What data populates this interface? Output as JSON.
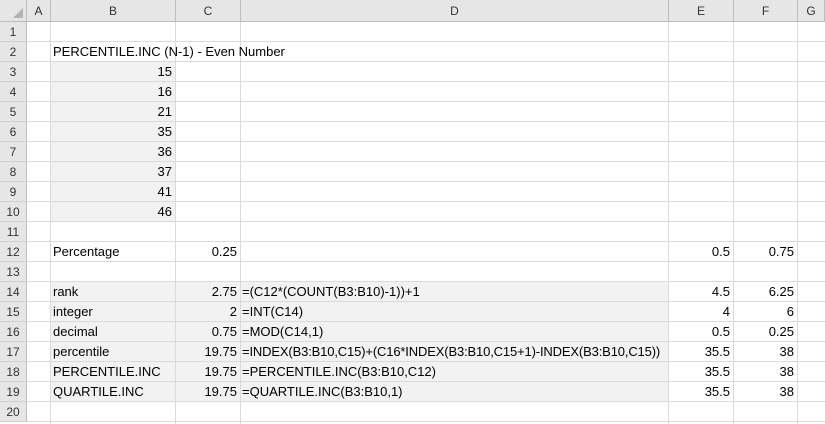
{
  "columns": [
    "A",
    "B",
    "C",
    "D",
    "E",
    "F",
    "G"
  ],
  "rows": [
    "1",
    "2",
    "3",
    "4",
    "5",
    "6",
    "7",
    "8",
    "9",
    "10",
    "11",
    "12",
    "13",
    "14",
    "15",
    "16",
    "17",
    "18",
    "19",
    "20"
  ],
  "title": "PERCENTILE.INC (N-1) - Even Number",
  "data_values": [
    "15",
    "16",
    "21",
    "35",
    "36",
    "37",
    "41",
    "46"
  ],
  "percentage": {
    "label": "Percentage",
    "c": "0.25",
    "e": "0.5",
    "f": "0.75"
  },
  "calc_rows": [
    {
      "label": "rank",
      "c": "2.75",
      "d": "=(C12*(COUNT(B3:B10)-1))+1",
      "e": "4.5",
      "f": "6.25"
    },
    {
      "label": "integer",
      "c": "2",
      "d": "=INT(C14)",
      "e": "4",
      "f": "6"
    },
    {
      "label": "decimal",
      "c": "0.75",
      "d": "=MOD(C14,1)",
      "e": "0.5",
      "f": "0.25"
    },
    {
      "label": "percentile",
      "c": "19.75",
      "d": "=INDEX(B3:B10,C15)+(C16*INDEX(B3:B10,C15+1)-INDEX(B3:B10,C15))",
      "e": "35.5",
      "f": "38"
    },
    {
      "label": "PERCENTILE.INC",
      "c": "19.75",
      "d": "=PERCENTILE.INC(B3:B10,C12)",
      "e": "35.5",
      "f": "38"
    },
    {
      "label": "QUARTILE.INC",
      "c": "19.75",
      "d": "=QUARTILE.INC(B3:B10,1)",
      "e": "35.5",
      "f": "38"
    }
  ]
}
